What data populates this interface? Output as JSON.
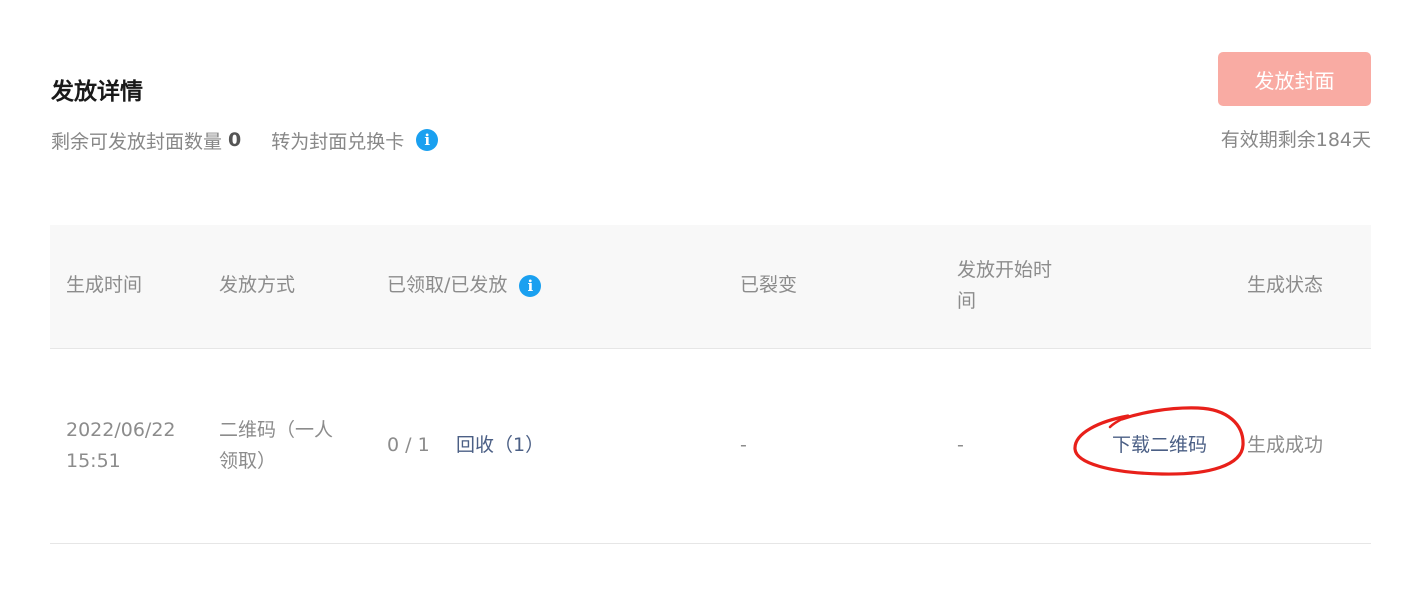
{
  "header": {
    "title": "发放详情",
    "remaining_label": "剩余可发放封面数量",
    "remaining_count": "0",
    "convert_label": "转为封面兑换卡",
    "issue_button": "发放封面",
    "validity": "有效期剩余184天"
  },
  "table": {
    "columns": [
      "生成时间",
      "发放方式",
      "已领取/已发放",
      "已裂变",
      "发放开始时间",
      "生成状态"
    ],
    "rows": [
      {
        "created_time": "2022/06/22 15:51",
        "method": "二维码（一人领取）",
        "claimed_issued": "0 / 1",
        "recall": "回收（1）",
        "fission": "-",
        "start_time": "-",
        "download": "下载二维码",
        "status": "生成成功"
      }
    ]
  },
  "colors": {
    "issue_button_bg": "#f9aba3",
    "info_icon": "#1aa0f0",
    "link": "#4b5f85",
    "annotation": "#e8201a"
  },
  "icons": {
    "info": "info-icon"
  }
}
